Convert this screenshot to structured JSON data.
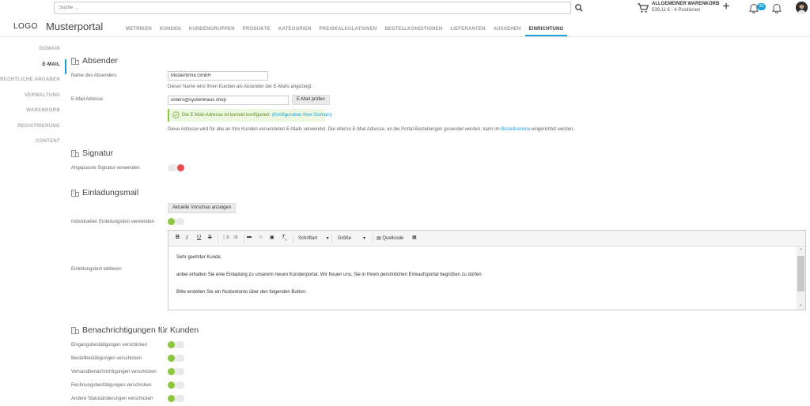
{
  "search": {
    "placeholder": "Suche ..."
  },
  "cart": {
    "title": "ALLGEMEINER WARENKORB",
    "summary": "539,11 € - 4 Positionen"
  },
  "notifications": {
    "count": "20"
  },
  "header": {
    "logo": "LOGO",
    "portal_title": "Musterportal"
  },
  "mainnav": [
    "METRIKEN",
    "KUNDEN",
    "KUNDENGRUPPEN",
    "PRODUKTE",
    "KATEGORIEN",
    "PREISKALKULATIONEN",
    "BESTELLKONDITIONEN",
    "LIEFERANTEN",
    "AUSSEHEN",
    "EINRICHTUNG"
  ],
  "mainnav_active": "EINRICHTUNG",
  "sidenav": [
    "DOMAIN",
    "E-MAIL",
    "RECHTLICHE ANGABEN",
    "VERWALTUNG",
    "WARENKORB",
    "REGISTRIERUNG",
    "CONTENT"
  ],
  "sidenav_active": "E-MAIL",
  "absender": {
    "title": "Absender",
    "name_label": "Name des Absenders",
    "name_value": "Musterfirma GmbH",
    "name_help": "Dieser Name wird Ihren Kunden als Absender der E-Mails angezeigt.",
    "email_label": "E-Mail Adresse",
    "email_value": "orders@systemhaus.shop",
    "check_button": "E-Mail prüfen",
    "success_text": "Die E-Mail-Adresse ist korrekt konfiguriert.",
    "success_link": "(Konfiguration Ihrer Domain)",
    "info_text": "Diese Adresse wird für alle an Ihre Kunden versendeten E-Mails verwendet. Die interne E-Mail Adresse, an die Portal-Bestellungen gesendet werden, kann im",
    "info_link": "Bestellservice",
    "info_suffix": "eingerichtet werden."
  },
  "signatur": {
    "title": "Signatur",
    "custom_label": "Angepasste Signatur verwenden",
    "custom_enabled": false
  },
  "einladung": {
    "title": "Einladungsmail",
    "preview_button": "Aktuelle Vorschau anzeigen",
    "custom_text_label": "Individuellen Einleitungstext verwenden",
    "custom_text_enabled": true,
    "edit_label": "Einleitungstext editieren",
    "toolbar": {
      "font": "Schriftart",
      "size": "Größe",
      "source": "Quellcode"
    },
    "body": [
      "Sehr geehrter Kunde,",
      "anbei erhalten Sie eine Einladung zu unserem neuen Kundenportal. Wir freuen uns, Sie in Ihrem persönlichen Einkaufsportal begrüßen zu dürfen.",
      "Bitte erstellen Sie ein Nutzerkonto über den folgenden Button:"
    ]
  },
  "benachrichtigungen": {
    "title": "Benachrichtigungen für Kunden",
    "items": [
      {
        "label": "Eingangsbestätigungen verschicken",
        "enabled": true
      },
      {
        "label": "Bestellbestätigungen verschicken",
        "enabled": true
      },
      {
        "label": "Versandbenachrichtigungen verschicken",
        "enabled": true
      },
      {
        "label": "Rechnungsbestätigungen verschicken",
        "enabled": true
      },
      {
        "label": "Andere Statusänderungen verschicken",
        "enabled": true
      }
    ]
  },
  "colors": {
    "accent": "#1ba3d7",
    "toggle_on": "#8dc63f",
    "toggle_off": "#e84c4c"
  }
}
